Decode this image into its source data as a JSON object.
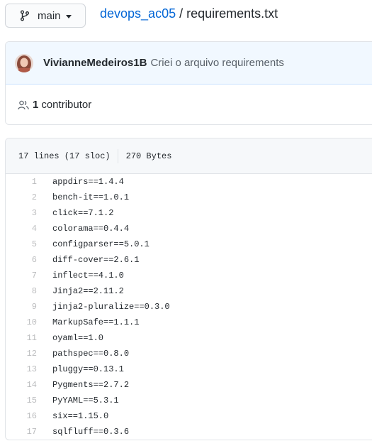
{
  "branch": {
    "name": "main",
    "icon": "git-branch-icon"
  },
  "breadcrumb": {
    "repo": "devops_ac05",
    "separator": "/",
    "file": "requirements.txt"
  },
  "commit": {
    "author": "VivianneMedeiros1B",
    "message": "Criei o arquivo requirements"
  },
  "contributors": {
    "count": "1",
    "label": "contributor",
    "icon": "people-icon"
  },
  "file_info": {
    "lines": "17 lines (17 sloc)",
    "size": "270 Bytes"
  },
  "code_lines": [
    {
      "num": "1",
      "text": "appdirs==1.4.4"
    },
    {
      "num": "2",
      "text": "bench-it==1.0.1"
    },
    {
      "num": "3",
      "text": "click==7.1.2"
    },
    {
      "num": "4",
      "text": "colorama==0.4.4"
    },
    {
      "num": "5",
      "text": "configparser==5.0.1"
    },
    {
      "num": "6",
      "text": "diff-cover==2.6.1"
    },
    {
      "num": "7",
      "text": "inflect==4.1.0"
    },
    {
      "num": "8",
      "text": "Jinja2==2.11.2"
    },
    {
      "num": "9",
      "text": "jinja2-pluralize==0.3.0"
    },
    {
      "num": "10",
      "text": "MarkupSafe==1.1.1"
    },
    {
      "num": "11",
      "text": "oyaml==1.0"
    },
    {
      "num": "12",
      "text": "pathspec==0.8.0"
    },
    {
      "num": "13",
      "text": "pluggy==0.13.1"
    },
    {
      "num": "14",
      "text": "Pygments==2.7.2"
    },
    {
      "num": "15",
      "text": "PyYAML==5.3.1"
    },
    {
      "num": "16",
      "text": "six==1.15.0"
    },
    {
      "num": "17",
      "text": "sqlfluff==0.3.6"
    }
  ],
  "colors": {
    "link": "#0366d6",
    "commit_bg": "#f1f8ff",
    "header_bg": "#f6f8fa",
    "border": "#e1e4e8"
  }
}
